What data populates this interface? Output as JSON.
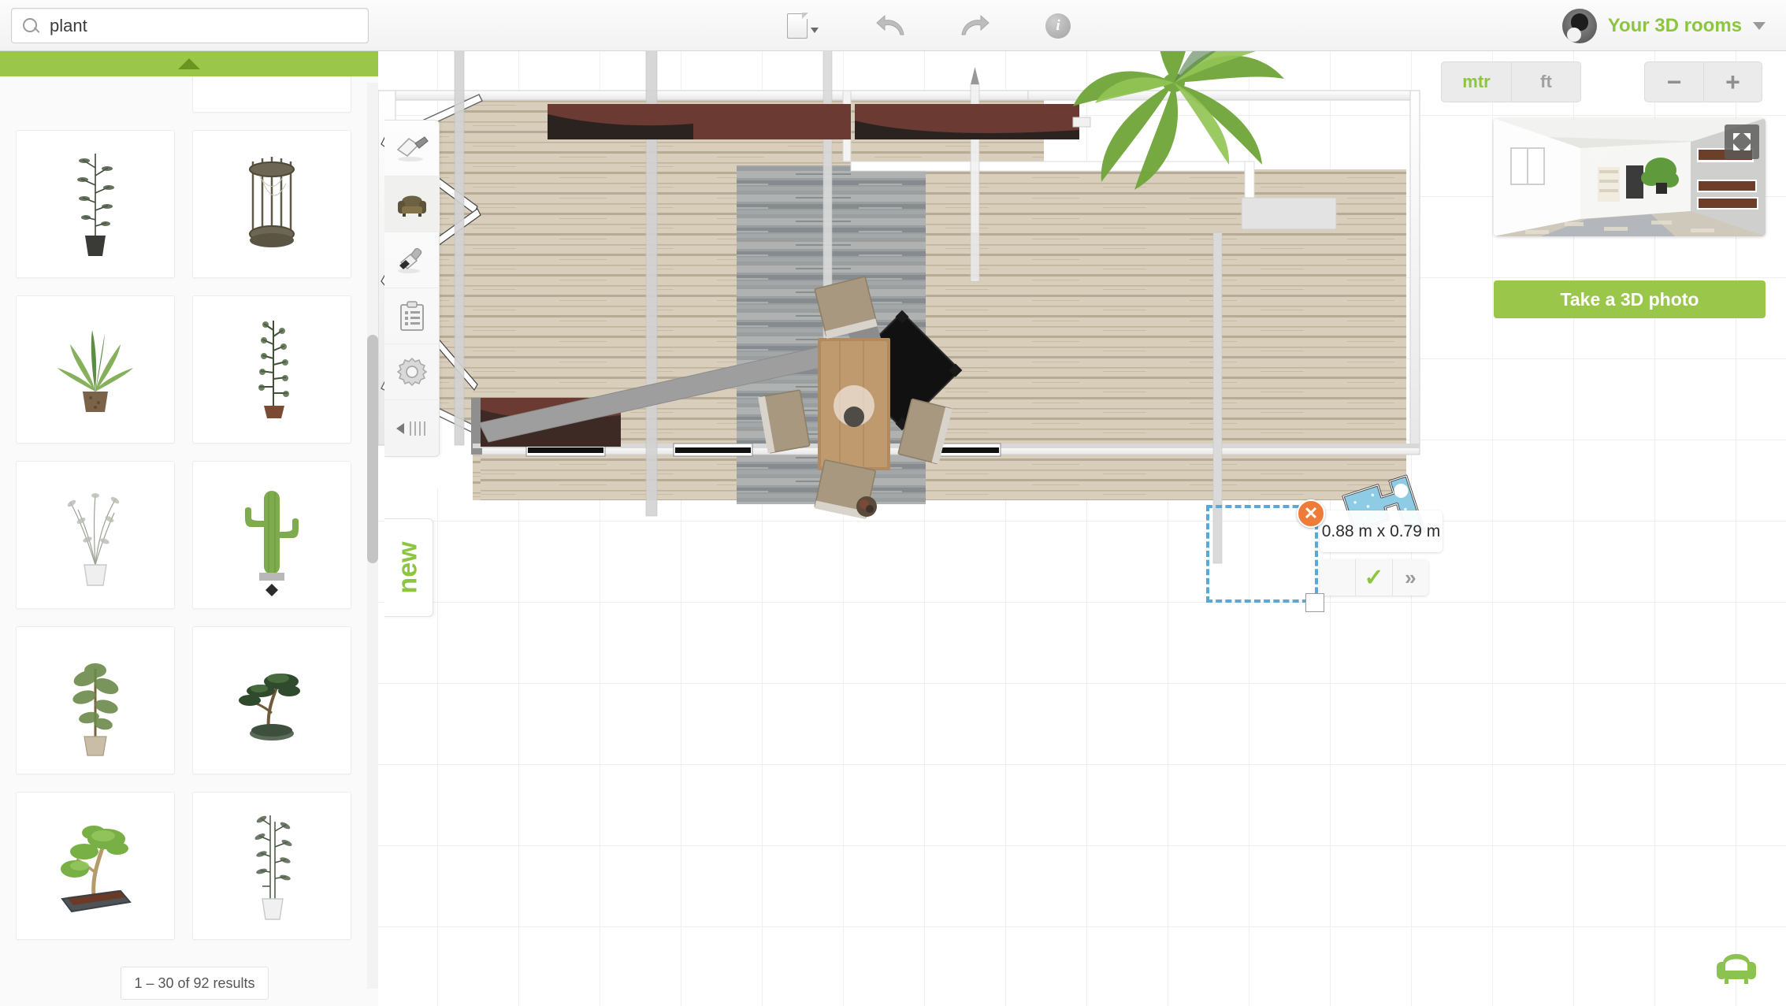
{
  "app": {
    "search": {
      "value": "plant",
      "placeholder": "Search"
    },
    "account": {
      "label": "Your 3D rooms"
    }
  },
  "toolbar": {
    "items": [
      {
        "name": "file-menu",
        "icon": "document-icon",
        "label": ""
      },
      {
        "name": "undo",
        "icon": "undo-icon",
        "label": ""
      },
      {
        "name": "redo",
        "icon": "redo-icon",
        "label": ""
      },
      {
        "name": "info",
        "icon": "info-icon",
        "label": "i"
      }
    ]
  },
  "catalog": {
    "scroll_up_label": "",
    "results_text": "1 – 30 of 92 results",
    "items": [
      {
        "label": "Dracaena in brown pot",
        "kind": "dracaena"
      },
      {
        "label": "Tall leafy plant in dark pot",
        "kind": "tall-leafy"
      },
      {
        "label": "Wire plant stand",
        "kind": "wire-stand"
      },
      {
        "label": "Agave in woven basket",
        "kind": "agave"
      },
      {
        "label": "Spiky bush in pot",
        "kind": "spiky"
      },
      {
        "label": "Wispy grass in pot",
        "kind": "wispy"
      },
      {
        "label": "Cactus in pot",
        "kind": "cactus"
      },
      {
        "label": "Small tree in pot",
        "kind": "small-tree"
      },
      {
        "label": "Bonsai in tray",
        "kind": "bonsai-dark"
      },
      {
        "label": "Bonsai in planter box",
        "kind": "bonsai-box"
      },
      {
        "label": "Bamboo in white pot",
        "kind": "bamboo"
      }
    ]
  },
  "rail": {
    "tools": [
      {
        "name": "build-tool",
        "icon": "trowel-icon",
        "selected": false
      },
      {
        "name": "furniture-tool",
        "icon": "armchair-icon",
        "selected": true
      },
      {
        "name": "materials-tool",
        "icon": "paintbrush-icon",
        "selected": false
      },
      {
        "name": "list-tool",
        "icon": "clipboard-icon",
        "selected": false
      },
      {
        "name": "settings-tool",
        "icon": "gear-icon",
        "selected": false
      },
      {
        "name": "collapse-rail",
        "icon": "collapse-icon",
        "selected": false
      }
    ],
    "new_tab_label": "new"
  },
  "viewcontrols": {
    "units": [
      {
        "label": "mtr",
        "active": true
      },
      {
        "label": "ft",
        "active": false
      }
    ],
    "zoom_out": "−",
    "zoom_in": "+",
    "take_photo_label": "Take a 3D photo",
    "expand_icon": "expand-arrows-icon"
  },
  "selection": {
    "dimensions": "0.88 m x 0.79 m",
    "close_label": "✕",
    "confirm_label": "✓",
    "next_label": "»"
  },
  "colors": {
    "accent_green": "#8cc63f",
    "bar_green": "#9ac64a",
    "orange": "#ef7b39",
    "selection_blue": "#5aa8d6"
  }
}
